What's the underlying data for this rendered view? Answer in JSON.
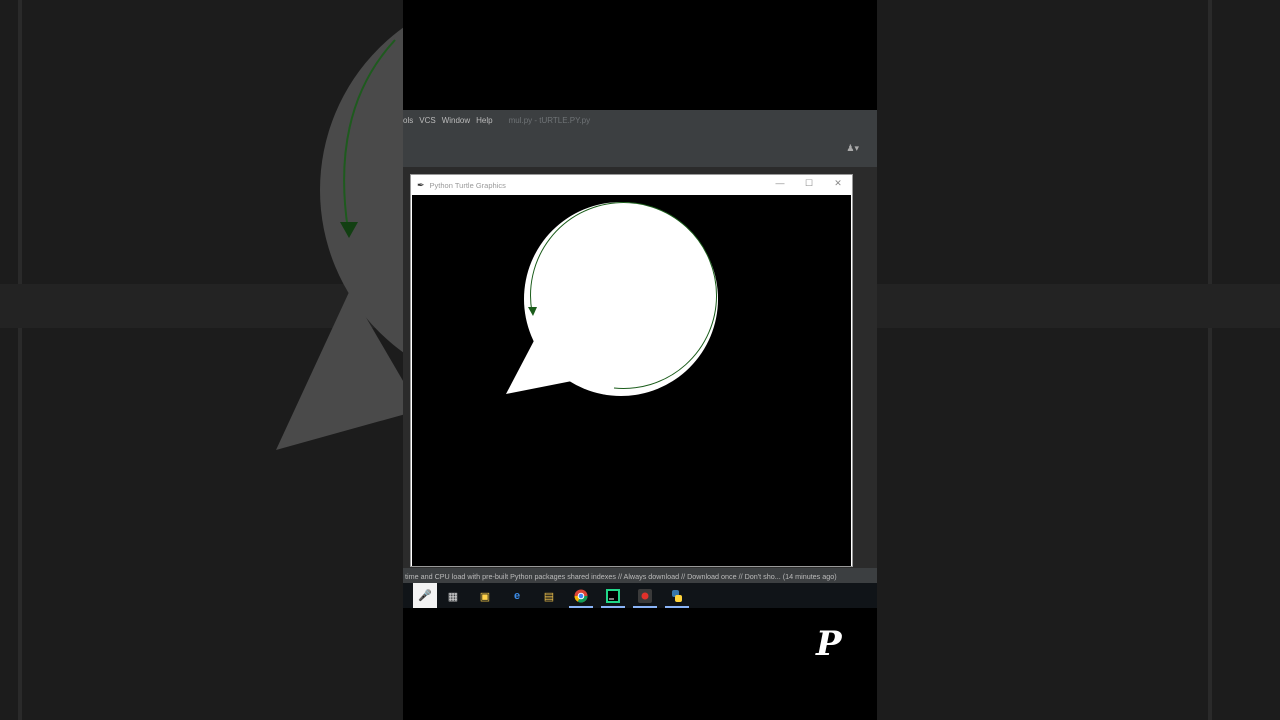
{
  "ide": {
    "menu": [
      "ols",
      "VCS",
      "Window",
      "Help"
    ],
    "file_title": "mul.py - tURTLE.PY.py",
    "status_text": "time and CPU load with pre-built Python packages shared indexes // Always download // Download once // Don't sho... (14 minutes ago)"
  },
  "turtle_window": {
    "title": "Python Turtle Graphics",
    "minimize": "—",
    "maximize": "☐",
    "close": "✕"
  },
  "taskbar": {
    "icons": [
      "mic-icon",
      "task-view-icon",
      "store-icon",
      "edge-icon",
      "folder-icon",
      "chrome-icon",
      "pycharm-icon",
      "record-icon",
      "python-icon"
    ]
  },
  "colors": {
    "canvas_bg": "#000000",
    "shape_fill": "#ffffff",
    "pen_color": "#1a5c1a"
  },
  "logo": {
    "letter": "P"
  }
}
